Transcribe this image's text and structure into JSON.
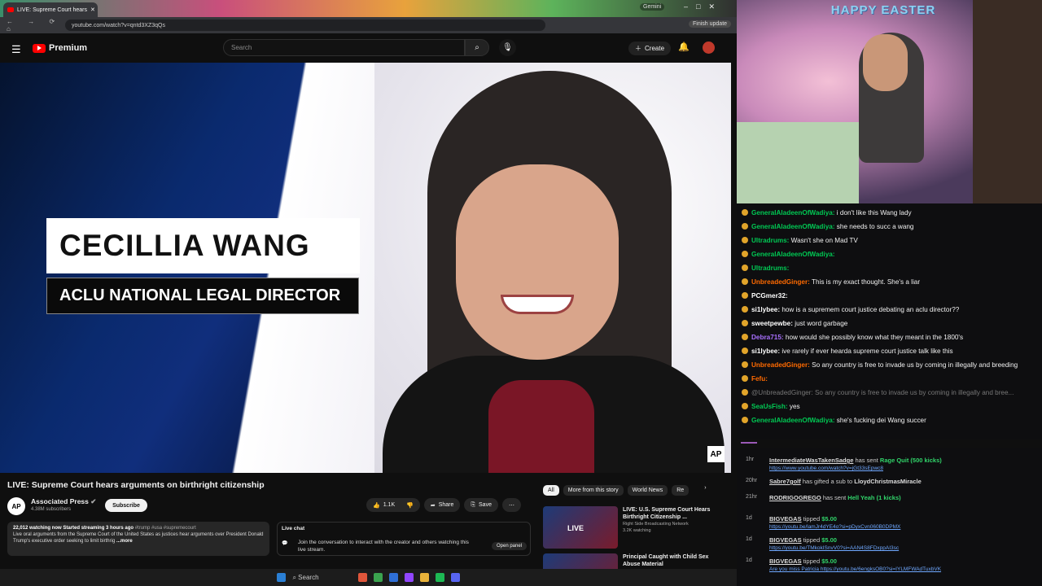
{
  "browser": {
    "tab_title": "LIVE: Supreme Court hears",
    "url": "youtube.com/watch?v=qntd3XZ3qQs",
    "gemini_label": "Gemini",
    "finish_update": "Finish update",
    "nav_glyphs": "← → ⟳ ⌂"
  },
  "youtube": {
    "logo": "Premium",
    "search_placeholder": "Search",
    "create_label": "Create",
    "video": {
      "lower_third_name": "CECILLIA WANG",
      "lower_third_title": "ACLU NATIONAL LEGAL DIRECTOR",
      "watermark": "AP"
    },
    "title": "LIVE: Supreme Court hears arguments on birthright citizenship",
    "channel": {
      "logo": "AP",
      "name": "Associated Press",
      "subscribers": "4.38M subscribers",
      "subscribe_label": "Subscribe"
    },
    "actions": {
      "likes": "1.1K",
      "share": "Share",
      "save": "Save"
    },
    "description": {
      "stats": "22,012 watching now  Started streaming 3 hours ago",
      "tags": "#trump #usa #supremecourt",
      "text": "Live oral arguments from the Supreme Court of the United States as justices hear arguments over President Donald Trump's executive order seeking to limit birthrig",
      "more": "...more"
    },
    "live_chat": {
      "title": "Live chat",
      "join_text": "Join the conversation to interact with the creator and others watching this live stream.",
      "open_panel": "Open panel"
    },
    "chips": [
      "All",
      "More from this story",
      "World News",
      "Re"
    ],
    "recommendations": [
      {
        "thumb_label": "LIVE",
        "title": "LIVE: U.S. Supreme Court Hears Birthright Citizenship ...",
        "channel": "Right Side Broadcasting Network",
        "meta": "3.2K watching"
      },
      {
        "thumb_label": "",
        "title": "Principal Caught with Child Sex Abuse Material",
        "channel": "",
        "meta": ""
      }
    ],
    "taskbar_search": "Search"
  },
  "stream": {
    "easter_sign": "HAPPY EASTER",
    "chat": [
      {
        "user": "GeneralAladeenOfWadiya",
        "text": "i don't like this Wang lady",
        "color": "#00c853"
      },
      {
        "user": "GeneralAladeenOfWadiya",
        "text": "she needs to succ a wang",
        "color": "#00c853"
      },
      {
        "user": "Ultradrums",
        "text": "Wasn't she on Mad TV",
        "color": "#00c853"
      },
      {
        "user": "GeneralAladeenOfWadiya",
        "text": "",
        "color": "#00c853"
      },
      {
        "user": "Ultradrums",
        "text": "",
        "color": "#00c853"
      },
      {
        "user": "UnbreadedGinger",
        "text": "This is my exact thought. She's a liar",
        "color": "#ff6a00"
      },
      {
        "user": "PCGmer32",
        "text": "",
        "color": "#ffffff"
      },
      {
        "user": "si1lybee",
        "text": "how is a supremem court justice debating an aclu director??",
        "color": "#ffffff"
      },
      {
        "user": "sweetpewbe",
        "text": "just word garbage",
        "color": "#ffffff"
      },
      {
        "user": "Debra715",
        "text": "how would she possibly know what they meant in the 1800's",
        "color": "#a970ff"
      },
      {
        "user": "si1lybee",
        "text": "ive rarely if ever hearda supreme court justice talk like this",
        "color": "#ffffff"
      },
      {
        "user": "UnbreadedGinger",
        "text": "So any country is free to invade us by coming in illegally and breeding",
        "color": "#ff6a00"
      },
      {
        "user": "Fefu",
        "text": "",
        "color": "#ff6a00"
      },
      {
        "user": "@UnbreadedGinger",
        "text": "So any country is free to invade us by coming in illegally and bree...",
        "color": "#777777"
      },
      {
        "user": "SeaUsFish",
        "text": "yes",
        "color": "#00c853"
      },
      {
        "user": "GeneralAladeenOfWadiya",
        "text": "she's fucking dei Wang succer",
        "color": "#00c853"
      }
    ],
    "events": [
      {
        "time": "1hr",
        "user": "IntermediateWasTakenSadge",
        "action": "has sent",
        "highlight": "Rage Quit (500 kicks)",
        "link": "https://www.youtube.com/watch?v=jGt33sEpwc8"
      },
      {
        "time": "20hr",
        "user": "Sabre7golf",
        "action": "has gifted a sub to",
        "highlight": "LloydChristmasMiracle",
        "link": ""
      },
      {
        "time": "21hr",
        "user": "RODRIGOGREGO",
        "action": "has sent",
        "highlight": "Hell Yeah (1 kicks)",
        "link": ""
      },
      {
        "time": "1d",
        "user": "BIGVEGAS",
        "action": "tipped",
        "highlight": "$5.00",
        "link": "https://youtu.be/lamJr4dYE4o?si=pDyxCvn060B0DPMX"
      },
      {
        "time": "1d",
        "user": "BIGVEGAS",
        "action": "tipped",
        "highlight": "$5.00",
        "link": "https://youtu.be/TMkokISnvV0?si=AAN4S8FDxppAI3sc"
      },
      {
        "time": "1d",
        "user": "BIGVEGAS",
        "action": "tipped",
        "highlight": "$5.00",
        "link": "Are you miss Patricia https://youtu.be/6engksOB0?si=IYLMFWAdTuxbVK"
      }
    ]
  }
}
